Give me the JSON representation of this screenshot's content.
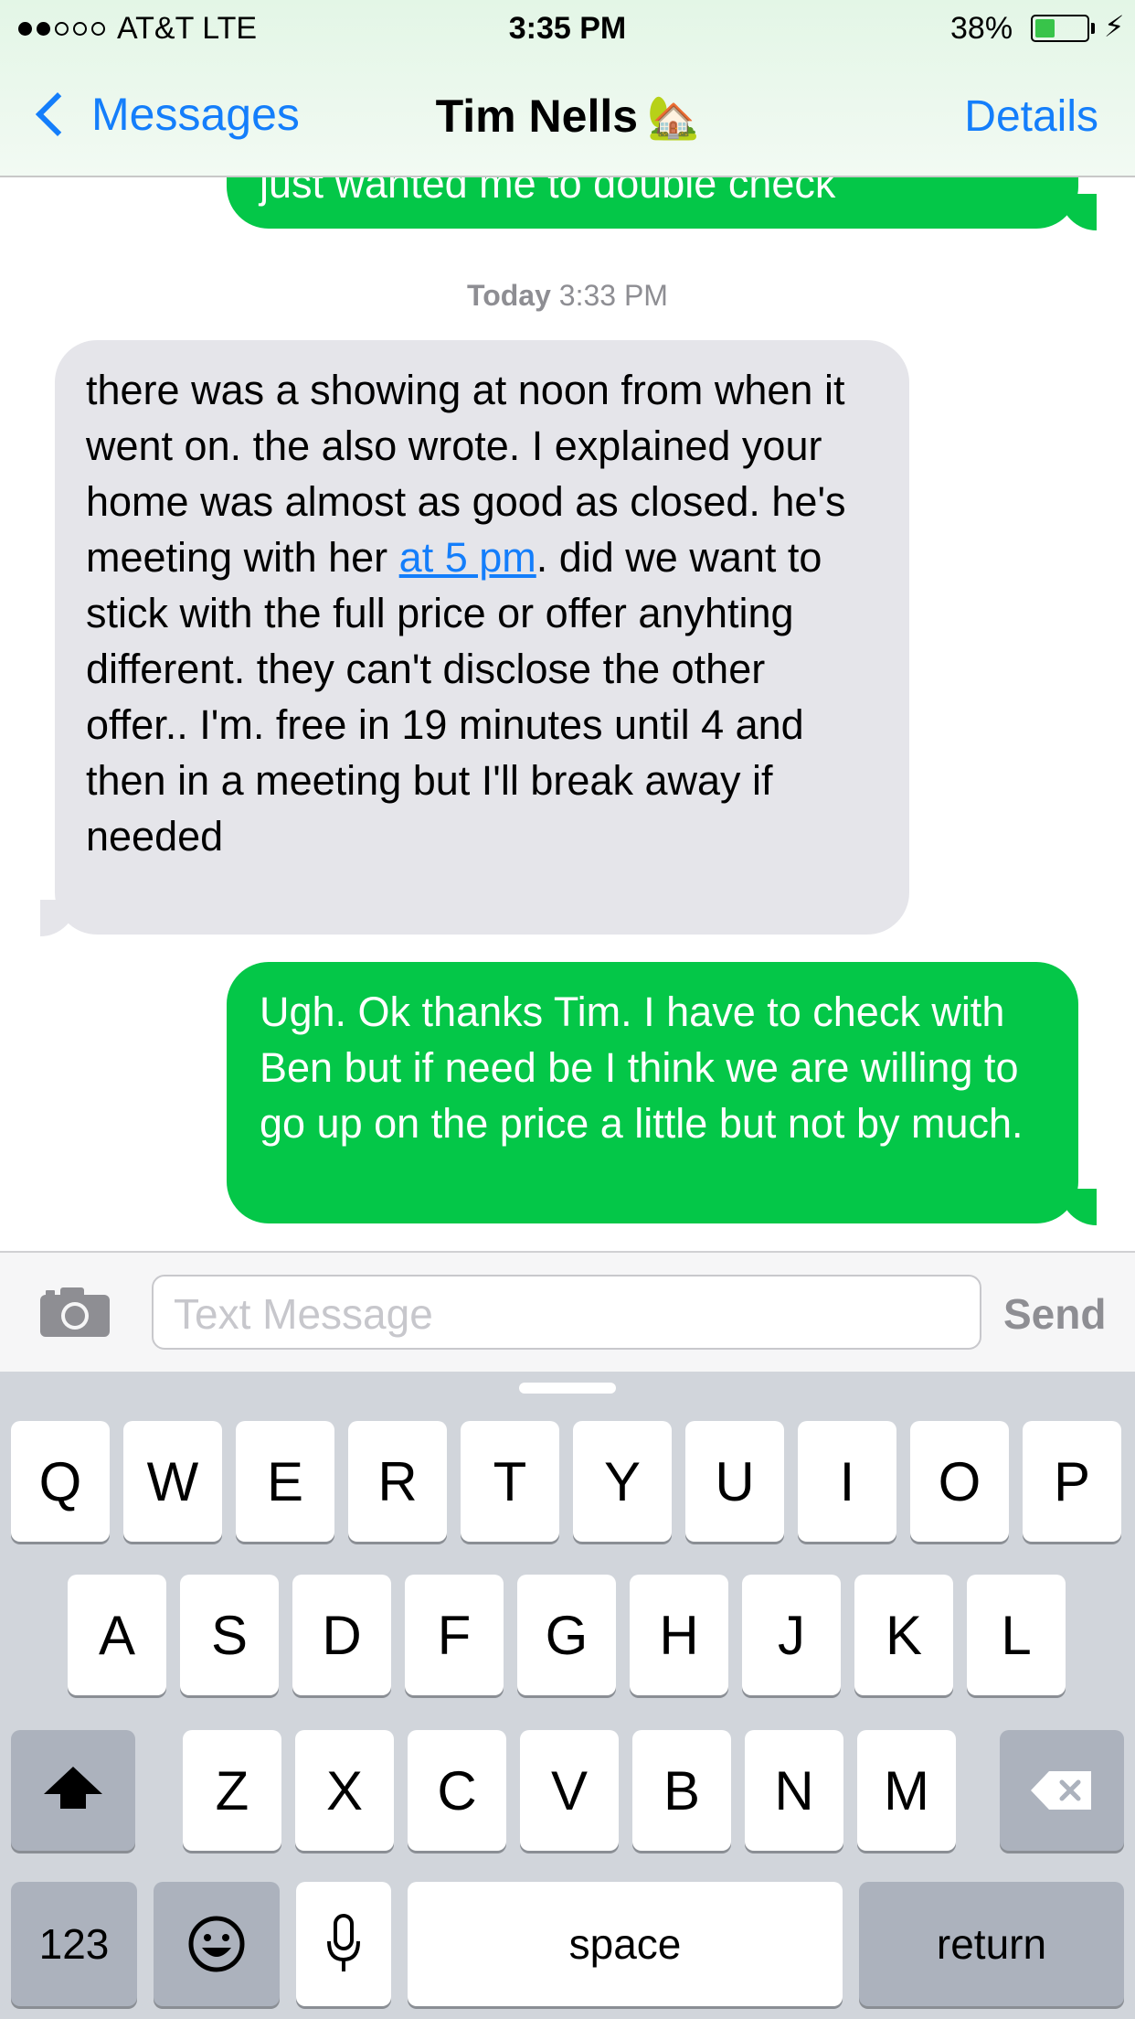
{
  "status_bar": {
    "signal_dots_filled": 2,
    "signal_dots_total": 5,
    "carrier": "AT&T  LTE",
    "time": "3:35 PM",
    "battery_percent": "38%",
    "battery_level": 0.38,
    "battery_color": "#38c44a"
  },
  "nav": {
    "back_label": "Messages",
    "contact_name": "Tim Nells",
    "contact_emoji": "🏡",
    "details_label": "Details"
  },
  "conversation": {
    "previous_sent": "just wanted me to double check",
    "timestamp_day": "Today",
    "timestamp_time": "3:33 PM",
    "received_before_link": "there was a showing at noon from when it went on. the also wrote. I explained your home was almost as good as closed. he's meeting with her ",
    "received_link": "at 5 pm",
    "received_after_link": ". did we want to stick with the full price or offer anyhting different. they can't disclose the other offer.. I'm. free in 19 minutes until 4 and then in a meeting but I'll break away if needed",
    "sent": "Ugh. Ok thanks Tim. I have to check with Ben but if need be I think we are willing to go up on the price a little but not by much."
  },
  "input": {
    "placeholder": "Text Message",
    "send_label": "Send",
    "camera_icon": "camera-icon"
  },
  "keyboard": {
    "row1": [
      "Q",
      "W",
      "E",
      "R",
      "T",
      "Y",
      "U",
      "I",
      "O",
      "P"
    ],
    "row2": [
      "A",
      "S",
      "D",
      "F",
      "G",
      "H",
      "J",
      "K",
      "L"
    ],
    "row3": [
      "Z",
      "X",
      "C",
      "V",
      "B",
      "N",
      "M"
    ],
    "numbers_label": "123",
    "space_label": "space",
    "return_label": "return",
    "emoji_icon": "emoji-icon",
    "mic_icon": "microphone-icon",
    "shift_icon": "shift-icon",
    "delete_icon": "delete-icon"
  },
  "colors": {
    "accent": "#147efb",
    "sent_bubble": "#04c748",
    "received_bubble": "#e5e5ea"
  }
}
